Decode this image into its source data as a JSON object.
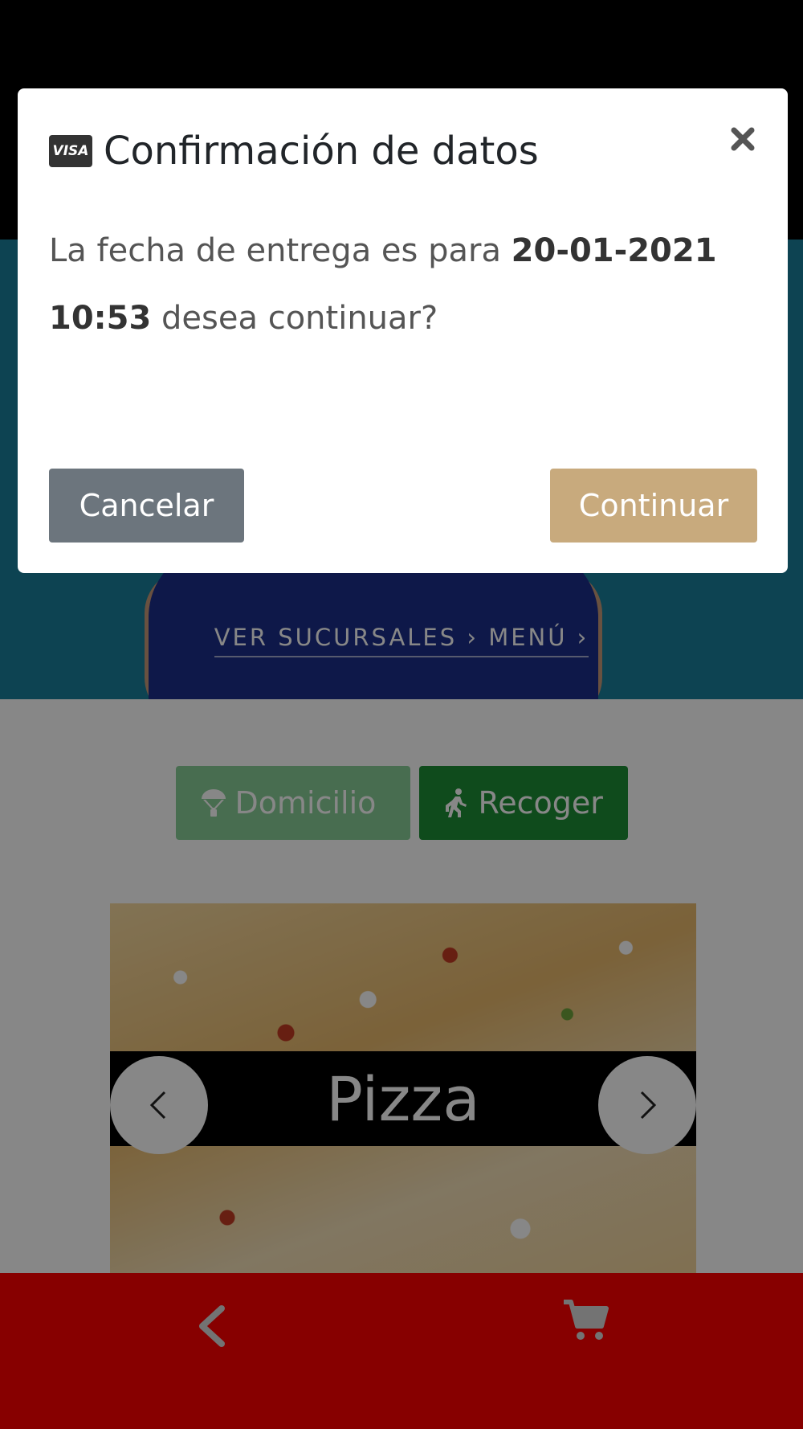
{
  "hero": {
    "links": "VER SUCURSALES › MENÚ ›"
  },
  "order_mode": {
    "domicilio_label": "Domicilio",
    "recoger_label": "Recoger"
  },
  "carousel": {
    "category_label": "Pizza"
  },
  "modal": {
    "title": "Confirmación de datos",
    "card_brand": "VISA",
    "message_prefix": "La fecha de entrega es para ",
    "date": "20-01-2021",
    "time": "10:53",
    "message_suffix": " desea continuar?",
    "cancel_label": "Cancelar",
    "continue_label": "Continuar"
  },
  "colors": {
    "bottom_bar": "#ff0000",
    "continue_button": "#c8aa7d",
    "cancel_button": "#6c757d",
    "recoger_button": "#1e8f36"
  }
}
